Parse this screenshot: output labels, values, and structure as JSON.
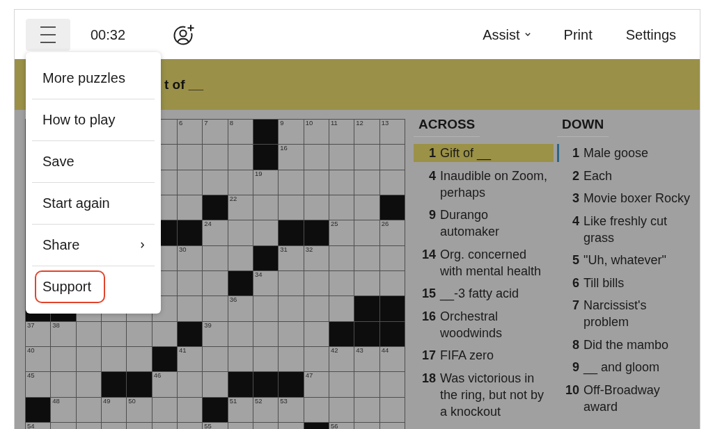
{
  "toolbar": {
    "menu_button": {
      "expanded": true
    },
    "timer": "00:32",
    "actions": [
      {
        "label": "Assist",
        "dropdown": true
      },
      {
        "label": "Print",
        "dropdown": false
      },
      {
        "label": "Settings",
        "dropdown": false
      }
    ]
  },
  "menu": {
    "items": [
      {
        "label": "More puzzles",
        "submenu": false,
        "outlined": false
      },
      {
        "label": "How to play",
        "submenu": false,
        "outlined": false
      },
      {
        "label": "Save",
        "submenu": false,
        "outlined": false
      },
      {
        "label": "Start again",
        "submenu": false,
        "outlined": false
      },
      {
        "label": "Share",
        "submenu": true,
        "outlined": false
      },
      {
        "label": "Support",
        "submenu": false,
        "outlined": true
      }
    ]
  },
  "clue_bar": {
    "text": "t of __"
  },
  "grid": {
    "rows": [
      [
        null,
        null,
        null,
        null,
        null,
        {
          "black": false
        },
        {
          "black": false,
          "number": "6"
        },
        {
          "black": false,
          "number": "7"
        },
        {
          "black": false,
          "number": "8"
        },
        {
          "black": true
        },
        {
          "black": false,
          "number": "9"
        },
        {
          "black": false,
          "number": "10"
        },
        {
          "black": false,
          "number": "11"
        },
        {
          "black": false,
          "number": "12"
        },
        {
          "black": false,
          "number": "13"
        }
      ],
      [
        null,
        null,
        null,
        null,
        null,
        {
          "black": false
        },
        {
          "black": false
        },
        {
          "black": false
        },
        {
          "black": false
        },
        {
          "black": true
        },
        {
          "black": false,
          "number": "16"
        },
        {
          "black": false
        },
        {
          "black": false
        },
        {
          "black": false
        },
        {
          "black": false
        }
      ],
      [
        null,
        null,
        null,
        null,
        null,
        {
          "black": false
        },
        {
          "black": false
        },
        {
          "black": false
        },
        {
          "black": false
        },
        {
          "black": false,
          "number": "19"
        },
        {
          "black": false
        },
        {
          "black": false
        },
        {
          "black": false
        },
        {
          "black": false
        },
        {
          "black": false
        }
      ],
      [
        null,
        null,
        null,
        null,
        null,
        {
          "black": false
        },
        {
          "black": false
        },
        {
          "black": true
        },
        {
          "black": false,
          "number": "22"
        },
        {
          "black": false
        },
        {
          "black": false
        },
        {
          "black": false
        },
        {
          "black": false
        },
        {
          "black": false
        },
        {
          "black": true
        }
      ],
      [
        null,
        null,
        null,
        null,
        null,
        {
          "black": true
        },
        {
          "black": true
        },
        {
          "black": false,
          "number": "24"
        },
        {
          "black": false
        },
        {
          "black": false
        },
        {
          "black": true
        },
        {
          "black": true
        },
        {
          "black": false,
          "number": "25"
        },
        {
          "black": false
        },
        {
          "black": false,
          "number": "26"
        }
      ],
      [
        null,
        null,
        null,
        null,
        null,
        {
          "black": false
        },
        {
          "black": false,
          "number": "30"
        },
        {
          "black": false
        },
        {
          "black": false
        },
        {
          "black": true
        },
        {
          "black": false,
          "number": "31"
        },
        {
          "black": false,
          "number": "32"
        },
        {
          "black": false
        },
        {
          "black": false
        },
        {
          "black": false
        }
      ],
      [
        null,
        null,
        null,
        null,
        null,
        {
          "black": false
        },
        {
          "black": false
        },
        {
          "black": false
        },
        {
          "black": true
        },
        {
          "black": false,
          "number": "34"
        },
        {
          "black": false
        },
        {
          "black": false
        },
        {
          "black": false
        },
        {
          "black": false
        },
        {
          "black": false
        }
      ],
      [
        {
          "black": true
        },
        {
          "black": true
        },
        {
          "black": false
        },
        {
          "black": false
        },
        {
          "black": false
        },
        {
          "black": false
        },
        {
          "black": false
        },
        {
          "black": false
        },
        {
          "black": false,
          "number": "36"
        },
        {
          "black": false
        },
        {
          "black": false
        },
        {
          "black": false
        },
        {
          "black": false
        },
        {
          "black": true
        },
        {
          "black": true
        }
      ],
      [
        {
          "black": false,
          "number": "37"
        },
        {
          "black": false,
          "number": "38"
        },
        {
          "black": false
        },
        {
          "black": false
        },
        {
          "black": false
        },
        {
          "black": false
        },
        {
          "black": true
        },
        {
          "black": false,
          "number": "39"
        },
        {
          "black": false
        },
        {
          "black": false
        },
        {
          "black": false
        },
        {
          "black": false
        },
        {
          "black": true
        },
        {
          "black": true
        },
        {
          "black": true
        }
      ],
      [
        {
          "black": false,
          "number": "40"
        },
        {
          "black": false
        },
        {
          "black": false
        },
        {
          "black": false
        },
        {
          "black": false
        },
        {
          "black": true
        },
        {
          "black": false,
          "number": "41"
        },
        {
          "black": false
        },
        {
          "black": false
        },
        {
          "black": false
        },
        {
          "black": false
        },
        {
          "black": false
        },
        {
          "black": false,
          "number": "42"
        },
        {
          "black": false,
          "number": "43"
        },
        {
          "black": false,
          "number": "44"
        }
      ],
      [
        {
          "black": false,
          "number": "45"
        },
        {
          "black": false
        },
        {
          "black": false
        },
        {
          "black": true
        },
        {
          "black": true
        },
        {
          "black": false,
          "number": "46"
        },
        {
          "black": false
        },
        {
          "black": false
        },
        {
          "black": true
        },
        {
          "black": true
        },
        {
          "black": true
        },
        {
          "black": false,
          "number": "47"
        },
        {
          "black": false
        },
        {
          "black": false
        },
        {
          "black": false
        }
      ],
      [
        {
          "black": true
        },
        {
          "black": false,
          "number": "48"
        },
        {
          "black": false
        },
        {
          "black": false,
          "number": "49"
        },
        {
          "black": false,
          "number": "50"
        },
        {
          "black": false
        },
        {
          "black": false
        },
        {
          "black": true
        },
        {
          "black": false,
          "number": "51"
        },
        {
          "black": false,
          "number": "52"
        },
        {
          "black": false,
          "number": "53"
        },
        {
          "black": false
        },
        {
          "black": false
        },
        {
          "black": false
        },
        {
          "black": false
        }
      ],
      [
        {
          "black": false,
          "number": "54"
        },
        {
          "black": false
        },
        {
          "black": false
        },
        {
          "black": false
        },
        {
          "black": false
        },
        {
          "black": false
        },
        {
          "black": false
        },
        {
          "black": false,
          "number": "55"
        },
        {
          "black": false
        },
        {
          "black": false
        },
        {
          "black": false
        },
        {
          "black": true
        },
        {
          "black": false,
          "number": "56"
        },
        {
          "black": false
        },
        {
          "black": false
        }
      ]
    ]
  },
  "clues": {
    "across": {
      "title": "ACROSS",
      "items": [
        {
          "number": "1",
          "text": "Gift of __",
          "selected": true
        },
        {
          "number": "4",
          "text": "Inaudible on Zoom, perhaps",
          "selected": false
        },
        {
          "number": "9",
          "text": "Durango automaker",
          "selected": false
        },
        {
          "number": "14",
          "text": "Org. concerned with mental health",
          "selected": false
        },
        {
          "number": "15",
          "text": "__-3 fatty acid",
          "selected": false
        },
        {
          "number": "16",
          "text": "Orchestral woodwinds",
          "selected": false
        },
        {
          "number": "17",
          "text": "FIFA zero",
          "selected": false
        },
        {
          "number": "18",
          "text": "Was victorious in the ring, but not by a knockout",
          "selected": false
        }
      ]
    },
    "down": {
      "title": "DOWN",
      "items": [
        {
          "number": "1",
          "text": "Male goose",
          "related": true
        },
        {
          "number": "2",
          "text": "Each",
          "related": false
        },
        {
          "number": "3",
          "text": "Movie boxer Rocky",
          "related": false
        },
        {
          "number": "4",
          "text": "Like freshly cut grass",
          "related": false
        },
        {
          "number": "5",
          "text": "\"Uh, whatever\"",
          "related": false
        },
        {
          "number": "6",
          "text": "Till bills",
          "related": false
        },
        {
          "number": "7",
          "text": "Narcissist's problem",
          "related": false
        },
        {
          "number": "8",
          "text": "Did the mambo",
          "related": false
        },
        {
          "number": "9",
          "text": "__ and gloom",
          "related": false
        },
        {
          "number": "10",
          "text": "Off-Broadway award",
          "related": false
        }
      ]
    }
  }
}
